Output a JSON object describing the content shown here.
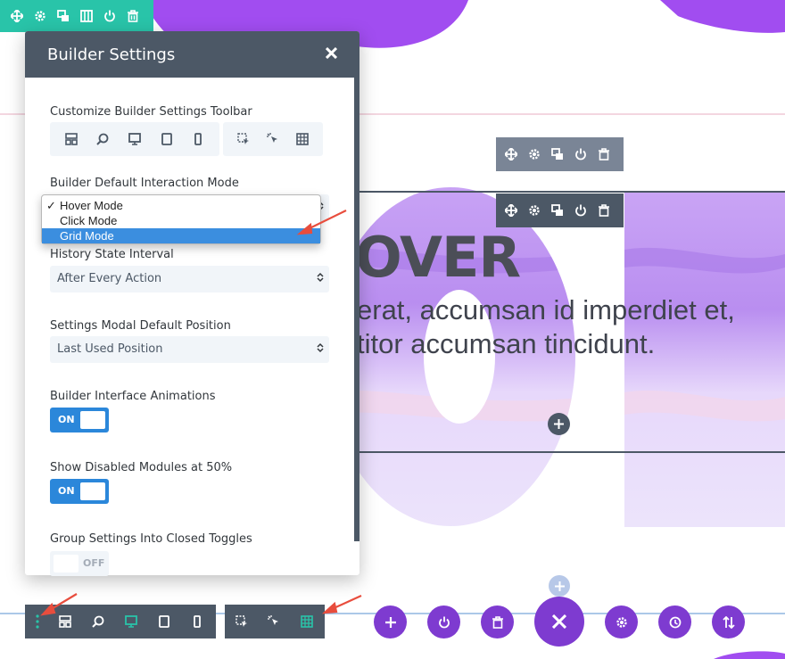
{
  "modal": {
    "title": "Builder Settings",
    "customize_label": "Customize Builder Settings Toolbar",
    "customize_icons_group1": [
      "wireframe-icon",
      "zoom-icon",
      "desktop-icon",
      "tablet-icon",
      "phone-icon"
    ],
    "customize_icons_group2": [
      "click-mode-icon",
      "hover-mode-icon",
      "grid-mode-icon"
    ],
    "interaction_label": "Builder Default Interaction Mode",
    "interaction_options": [
      "Hover Mode",
      "Click Mode",
      "Grid Mode"
    ],
    "interaction_checked": "Hover Mode",
    "interaction_highlighted": "Grid Mode",
    "history_label": "History State Interval",
    "history_value": "After Every Action",
    "position_label": "Settings Modal Default Position",
    "position_value": "Last Used Position",
    "animations_label": "Builder Interface Animations",
    "animations_state": "ON",
    "disabled_label": "Show Disabled Modules at 50%",
    "disabled_state": "ON",
    "group_label": "Group Settings Into Closed Toggles",
    "group_state": "OFF"
  },
  "hero": {
    "big_word": "OVER",
    "line1": "erat, accumsan id imperdiet et,",
    "line2": "titor accumsan tincidunt."
  },
  "section_toolbar": [
    "move-icon",
    "gear-icon",
    "duplicate-icon",
    "columns-icon",
    "power-icon",
    "trash-icon"
  ],
  "module_toolbar": [
    "move-icon",
    "gear-icon",
    "duplicate-icon",
    "power-icon",
    "trash-icon"
  ],
  "bottom_bar": {
    "left_group": [
      "menu-dots-icon",
      "wireframe-icon",
      "zoom-icon",
      "desktop-icon",
      "tablet-icon",
      "phone-icon"
    ],
    "mode_group": [
      "click-mode-icon",
      "hover-mode-icon",
      "grid-mode-icon"
    ],
    "actions": [
      "add-icon",
      "power-icon",
      "trash-icon",
      "close-icon",
      "gear-icon",
      "history-icon",
      "sort-icon"
    ]
  },
  "colors": {
    "accent_purple": "#7e3bd0",
    "toolbar_dark": "#4c5866",
    "section_green": "#29c4a9",
    "toggle_blue": "#2b87da",
    "arrow_red": "#e84d3d",
    "active_icon_green": "#29c4a9"
  }
}
